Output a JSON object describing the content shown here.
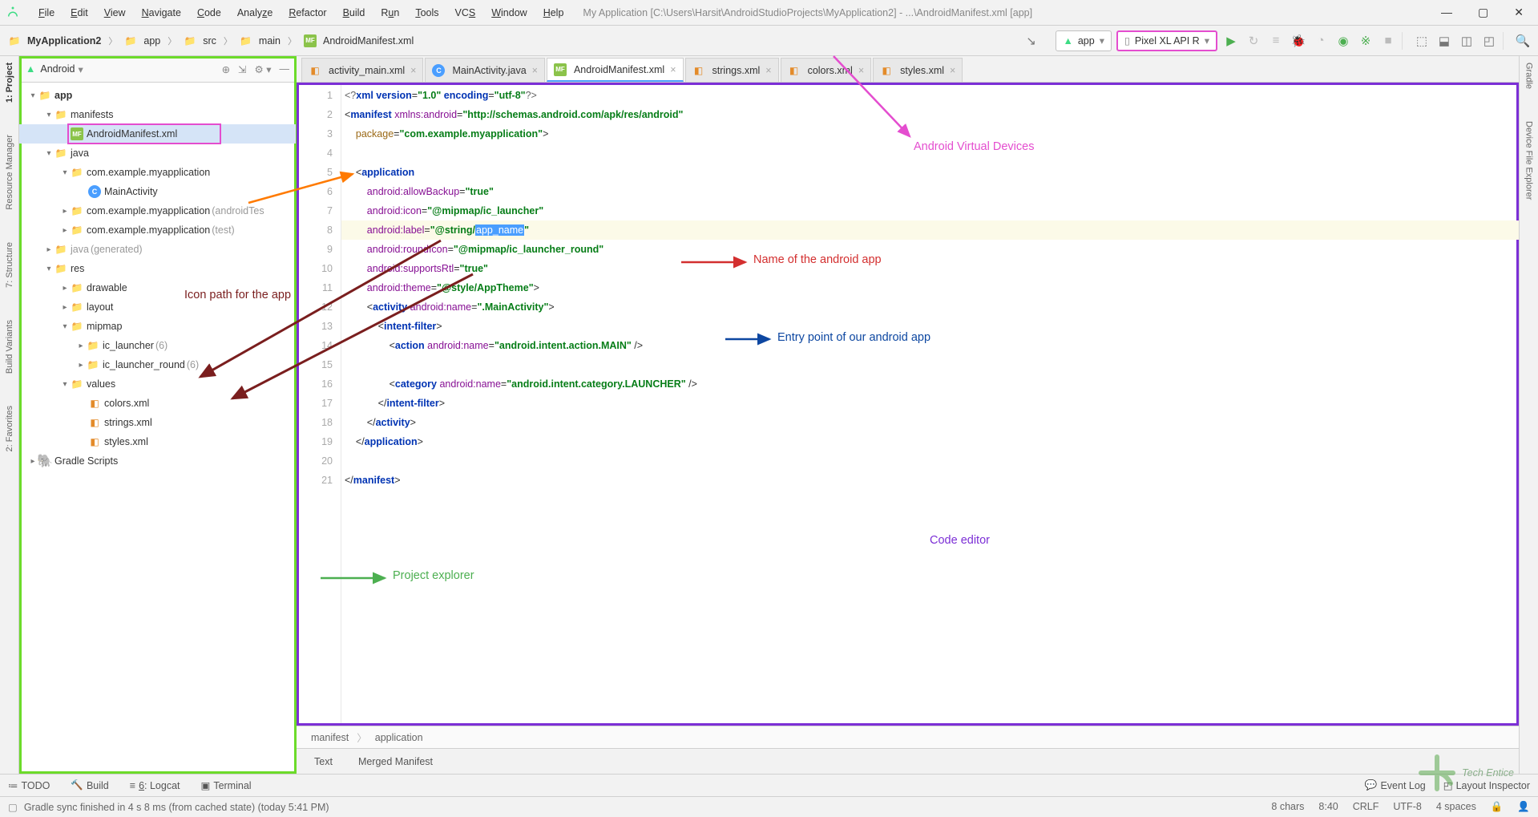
{
  "title": "My Application [C:\\Users\\Harsit\\AndroidStudioProjects\\MyApplication2] - ...\\AndroidManifest.xml [app]",
  "menu": [
    "File",
    "Edit",
    "View",
    "Navigate",
    "Code",
    "Analyze",
    "Refactor",
    "Build",
    "Run",
    "Tools",
    "VCS",
    "Window",
    "Help"
  ],
  "breadcrumb": [
    "MyApplication2",
    "app",
    "src",
    "main",
    "AndroidManifest.xml"
  ],
  "combo_app": "app",
  "combo_device": "Pixel XL API R",
  "left_rail": [
    "1: Project",
    "Resource Manager",
    "7: Structure",
    "Build Variants",
    "2: Favorites"
  ],
  "right_rail": [
    "Gradle",
    "Device File Explorer"
  ],
  "panel": {
    "view": "Android"
  },
  "tree": {
    "app": "app",
    "manifests": "manifests",
    "manifest_file": "AndroidManifest.xml",
    "java": "java",
    "pkg": "com.example.myapplication",
    "main_activity": "MainActivity",
    "pkg_at": "com.example.myapplication",
    "pkg_at_suffix": "(androidTes",
    "pkg_t": "com.example.myapplication",
    "pkg_t_suffix": "(test)",
    "java_gen": "java",
    "java_gen_suffix": "(generated)",
    "res": "res",
    "drawable": "drawable",
    "layout": "layout",
    "mipmap": "mipmap",
    "ic_launcher": "ic_launcher",
    "ic_launcher_cnt": "(6)",
    "ic_launcher_round": "ic_launcher_round",
    "ic_launcher_round_cnt": "(6)",
    "values": "values",
    "colors_xml": "colors.xml",
    "strings_xml": "strings.xml",
    "styles_xml": "styles.xml",
    "gradle_scripts": "Gradle Scripts"
  },
  "tabs": [
    "activity_main.xml",
    "MainActivity.java",
    "AndroidManifest.xml",
    "strings.xml",
    "colors.xml",
    "styles.xml"
  ],
  "active_tab": 2,
  "code_lines": 21,
  "annotations": {
    "avd": "Android Virtual Devices",
    "app_name": "Name of the android app",
    "entry": "Entry point of our android app",
    "icon_path": "Icon path for the app",
    "proj_exp": "Project explorer",
    "code_ed": "Code editor"
  },
  "crumb2": [
    "manifest",
    "application"
  ],
  "mode_tabs": [
    "Text",
    "Merged Manifest"
  ],
  "bottom": {
    "todo": "TODO",
    "build": "Build",
    "logcat": "6: Logcat",
    "terminal": "Terminal",
    "eventlog": "Event Log",
    "layout_insp": "Layout Inspector"
  },
  "status": {
    "msg": "Gradle sync finished in 4 s 8 ms (from cached state) (today 5:41 PM)",
    "chars": "8 chars",
    "pos": "8:40",
    "le": "CRLF",
    "enc": "UTF-8",
    "indent": "4 spaces"
  },
  "code": {
    "xml_decl": "<?xml version=\"1.0\" encoding=\"utf-8\"?>",
    "manifest_open": "manifest",
    "xmlns_attr": "xmlns:android",
    "xmlns_val": "\"http://schemas.android.com/apk/res/android\"",
    "package_attr": "package",
    "package_val": "\"com.example.myapplication\"",
    "application": "application",
    "allowBackup": "android:allowBackup",
    "true_val": "\"true\"",
    "icon": "android:icon",
    "icon_val": "\"@mipmap/ic_launcher\"",
    "label": "android:label",
    "label_prefix": "\"@string/",
    "label_hl": "app_name",
    "label_suffix": "\"",
    "roundIcon": "android:roundIcon",
    "roundIcon_val": "\"@mipmap/ic_launcher_round\"",
    "supportsRtl": "android:supportsRtl",
    "theme": "android:theme",
    "theme_val": "\"@style/AppTheme\"",
    "activity": "activity",
    "act_name": "android:name",
    "act_name_val": "\".MainActivity\"",
    "intent_filter": "intent-filter",
    "action": "action",
    "action_name_val": "\"android.intent.action.MAIN\"",
    "category": "category",
    "category_val": "\"android.intent.category.LAUNCHER\""
  }
}
